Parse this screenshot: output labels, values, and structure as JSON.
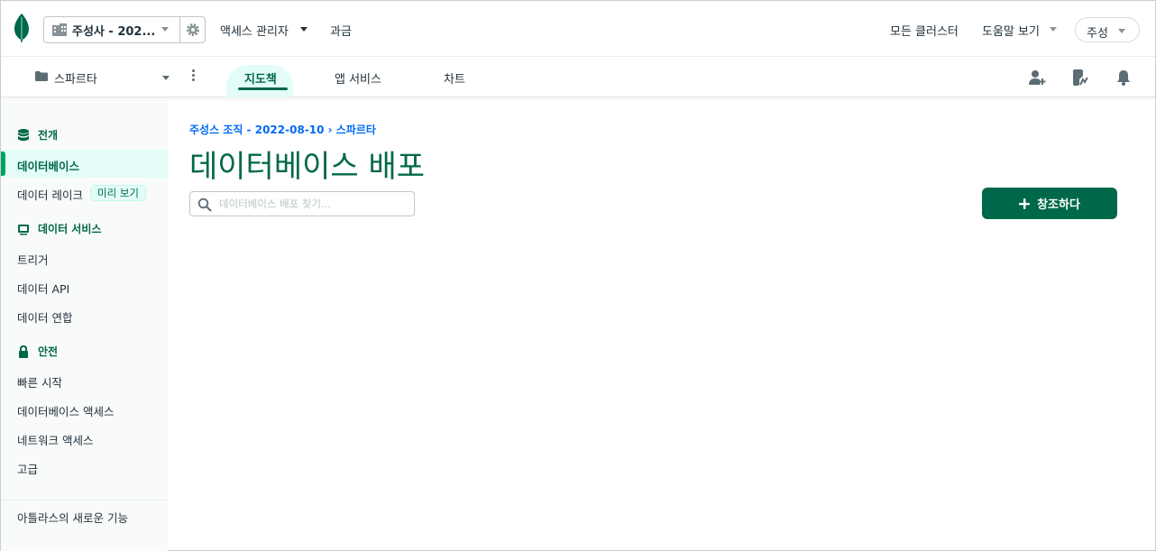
{
  "topbar": {
    "org_name": "주성사 - 202...",
    "access_manager": "액세스 관리자",
    "billing": "과금",
    "all_clusters": "모든 클러스터",
    "help": "도움말 보기",
    "user": "주성"
  },
  "projectbar": {
    "project_name": "스파르타",
    "tabs": [
      {
        "label": "지도책",
        "active": true
      },
      {
        "label": "앱 서비스",
        "active": false
      },
      {
        "label": "차트",
        "active": false
      }
    ]
  },
  "sidebar": {
    "sections": [
      {
        "title": "전개",
        "icon": "database-icon"
      },
      {
        "title": "데이터 서비스",
        "icon": "monitor-icon"
      },
      {
        "title": "안전",
        "icon": "lock-icon"
      }
    ],
    "items": {
      "databases": "데이터베이스",
      "data_lake": "데이터 레이크",
      "preview_badge": "미리 보기",
      "triggers": "트리거",
      "data_api": "데이터 API",
      "data_federation": "데이터 연합",
      "quick_start": "빠른 시작",
      "db_access": "데이터베이스 액세스",
      "network_access": "네트워크 액세스",
      "advanced": "고급",
      "whats_new": "아틀라스의 새로운 기능"
    }
  },
  "main": {
    "breadcrumb": "주성스 조직 - 2022-08-10 › 스파르타",
    "title": "데이터베이스 배포",
    "search_placeholder": "데이터베이스 배포 찾기...",
    "create_label": "창조하다"
  },
  "colors": {
    "brand_green": "#00684a",
    "accent_green": "#00a35c",
    "link_blue": "#016bf8",
    "active_bg": "#e3fcf7"
  }
}
